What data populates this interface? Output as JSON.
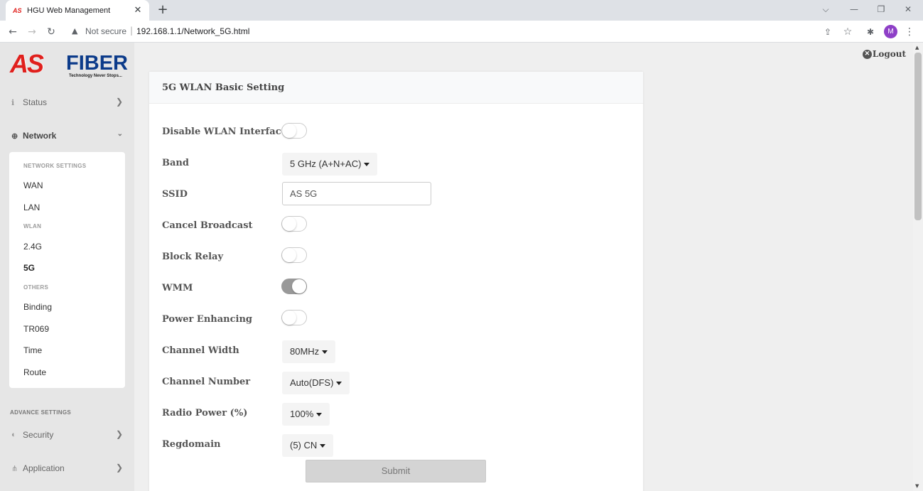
{
  "browser": {
    "tab_title": "HGU Web Management",
    "tab_favicon": "AS",
    "tab_close": "✕",
    "new_tab": "+",
    "security_label": "Not secure",
    "url": "192.168.1.1/Network_5G.html",
    "profile_initial": "M"
  },
  "logo": {
    "mark": "AS",
    "word": "FIBER",
    "tagline": "Technology Never Stops..."
  },
  "sidebar": {
    "status_label": "Status",
    "network_label": "Network",
    "network_settings_head": "NETWORK SETTINGS",
    "wan": "WAN",
    "lan": "LAN",
    "wlan_head": "WLAN",
    "wlan_24": "2.4G",
    "wlan_5": "5G",
    "others_head": "OTHERS",
    "binding": "Binding",
    "tr069": "TR069",
    "time": "Time",
    "route": "Route",
    "advance_head": "ADVANCE SETTINGS",
    "security_label": "Security",
    "application_label": "Application"
  },
  "header": {
    "logout": "Logout"
  },
  "form": {
    "title": "5G WLAN Basic Setting",
    "disable_wlan_label": "Disable WLAN Interface",
    "disable_wlan_on": false,
    "band_label": "Band",
    "band_value": "5 GHz (A+N+AC)",
    "ssid_label": "SSID",
    "ssid_value": "AS 5G",
    "cancel_broadcast_label": "Cancel Broadcast",
    "cancel_broadcast_on": false,
    "block_relay_label": "Block Relay",
    "block_relay_on": false,
    "wmm_label": "WMM",
    "wmm_on": true,
    "power_enhancing_label": "Power Enhancing",
    "power_enhancing_on": false,
    "channel_width_label": "Channel Width",
    "channel_width_value": "80MHz",
    "channel_number_label": "Channel Number",
    "channel_number_value": "Auto(DFS)",
    "radio_power_label": "Radio Power (%)",
    "radio_power_value": "100%",
    "regdomain_label": "Regdomain",
    "regdomain_value": "(5) CN",
    "submit_label": "Submit"
  }
}
